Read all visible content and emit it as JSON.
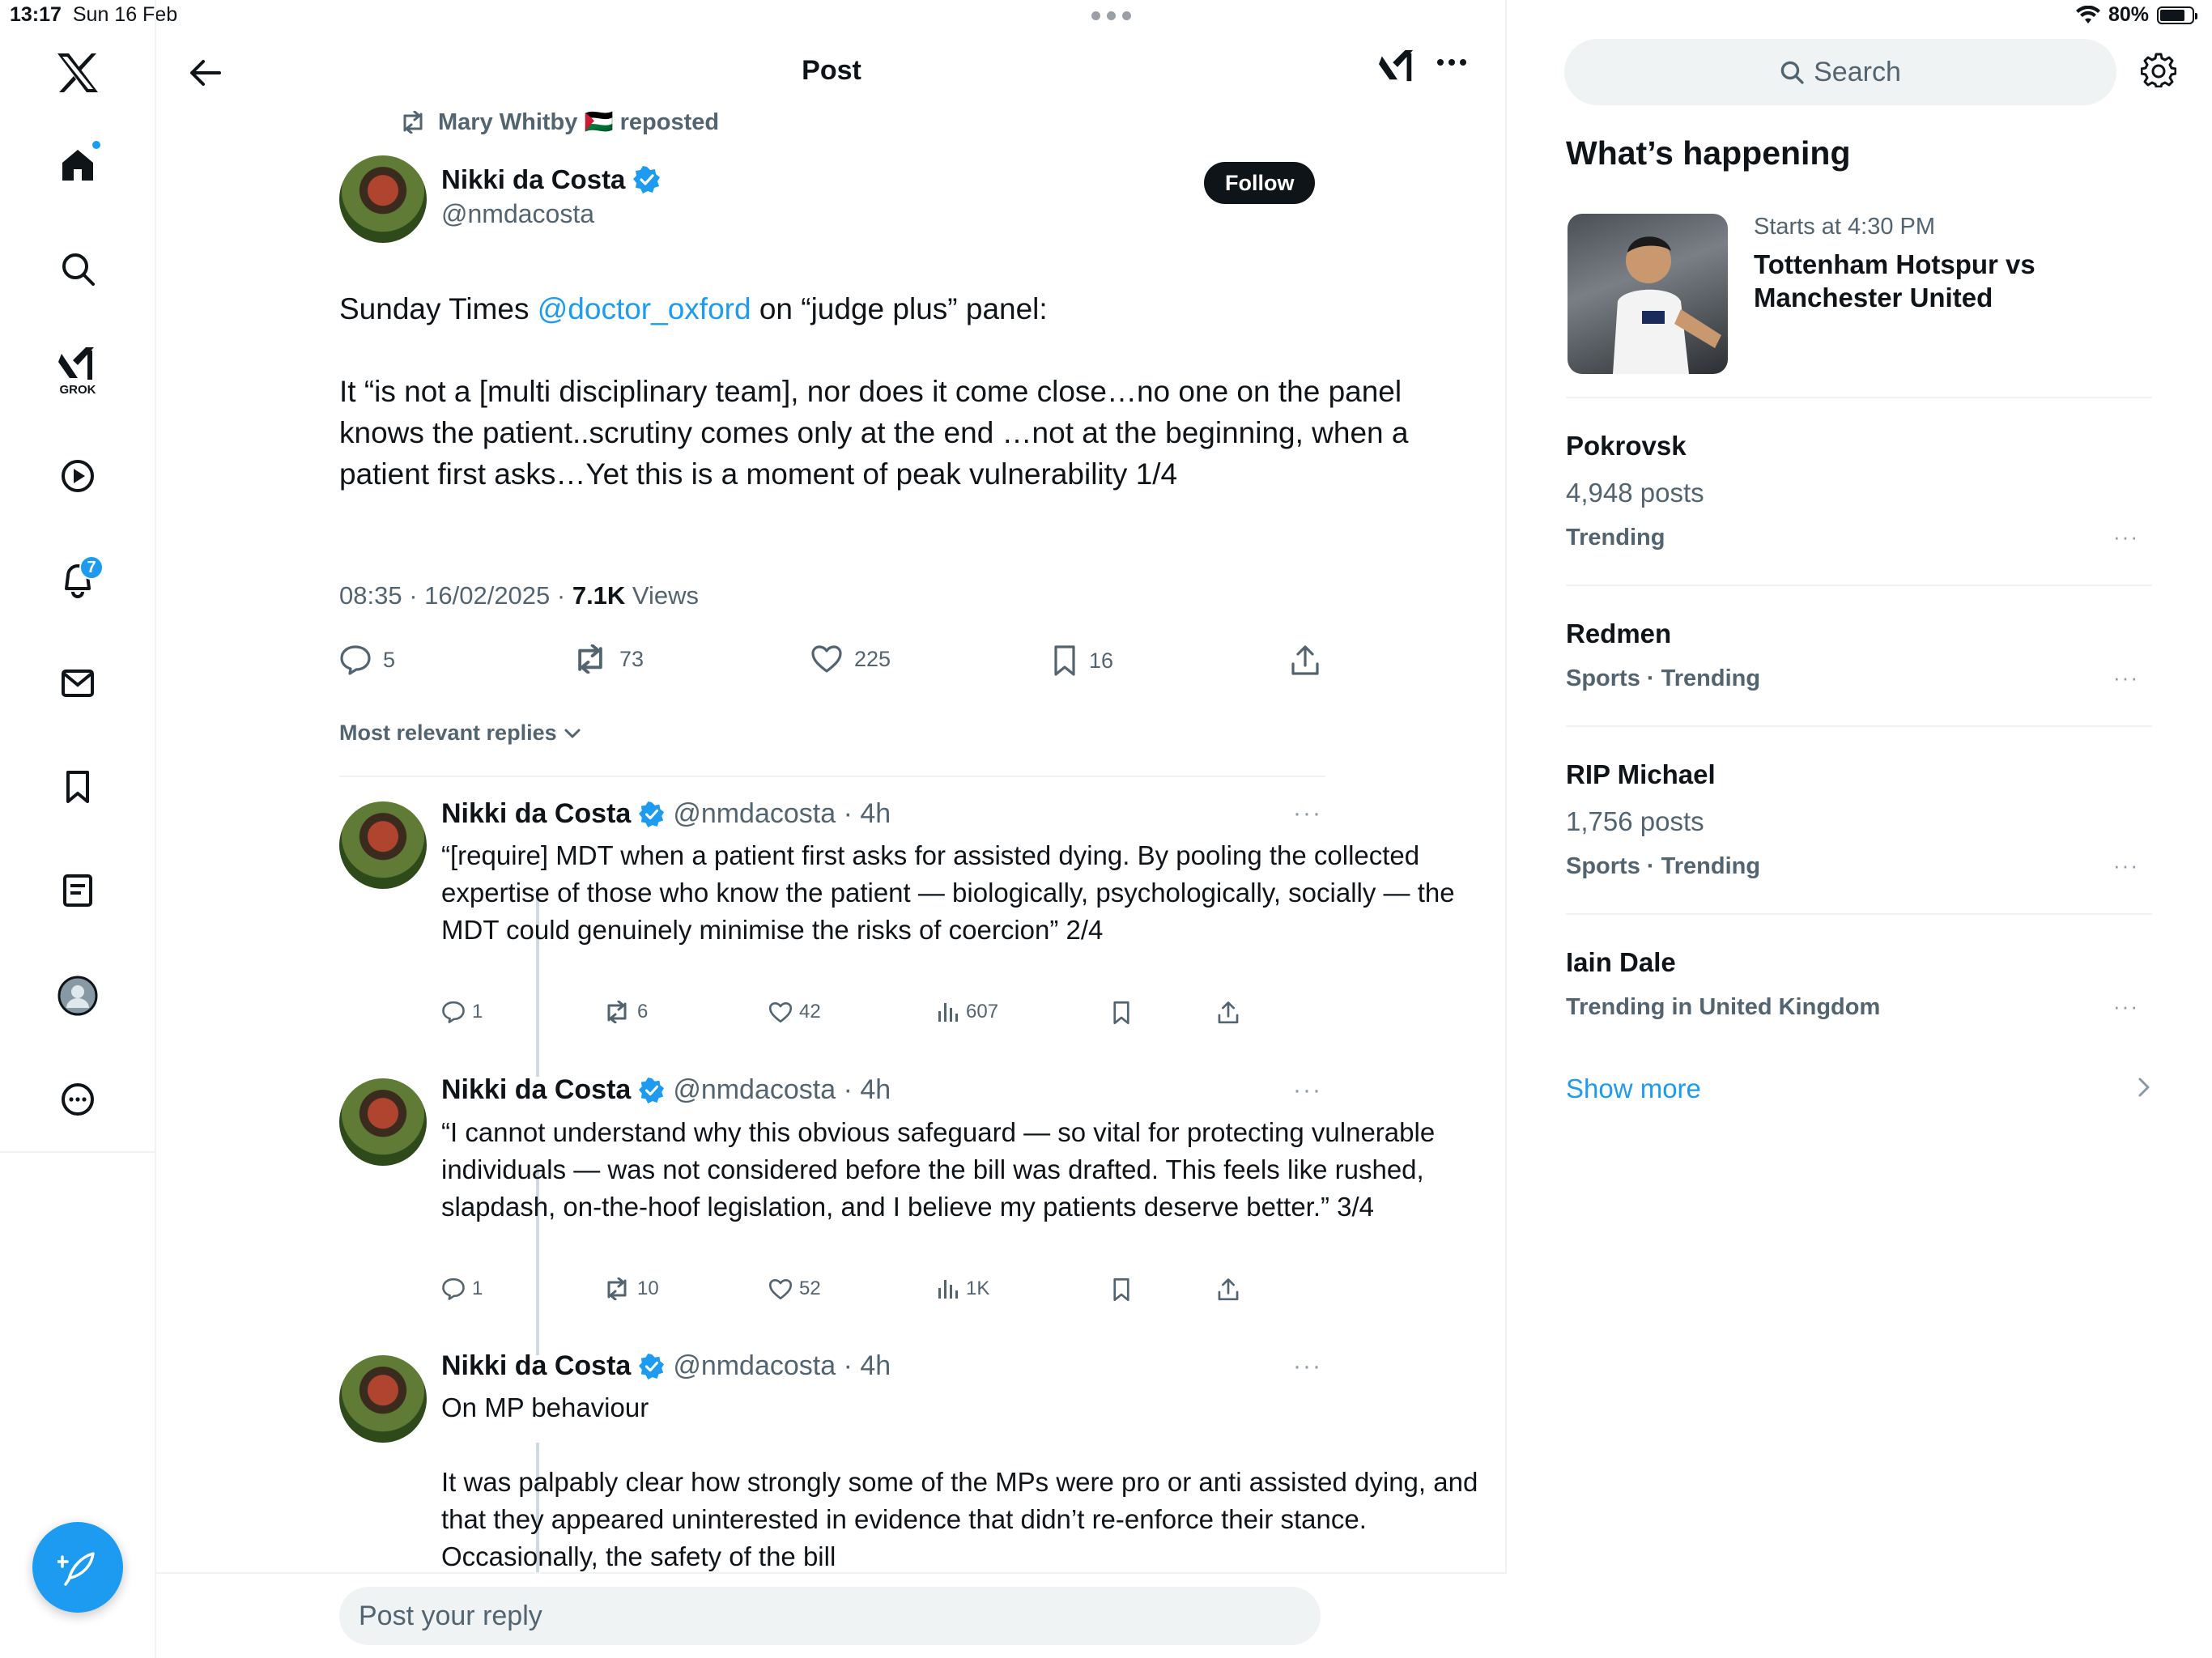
{
  "status_bar": {
    "time": "13:17",
    "date": "Sun 16 Feb",
    "battery": "80%",
    "battery_level": 0.8
  },
  "nav": {
    "items": [
      {
        "name": "x-logo-icon"
      },
      {
        "name": "home-icon"
      },
      {
        "name": "search-icon"
      },
      {
        "name": "grok-icon",
        "label": "GROK"
      },
      {
        "name": "video-icon"
      },
      {
        "name": "notifications-icon",
        "badge": "7"
      },
      {
        "name": "messages-icon"
      },
      {
        "name": "bookmarks-icon"
      },
      {
        "name": "lists-icon"
      },
      {
        "name": "profile-icon"
      },
      {
        "name": "more-icon"
      }
    ],
    "compose_icon": "feather-plus-icon"
  },
  "header": {
    "title": "Post"
  },
  "post": {
    "repost_by": "Mary Whitby 🇵🇸 reposted",
    "author": "Nikki da Costa",
    "handle": "@nmdacosta",
    "follow_label": "Follow",
    "text_1_pre": "Sunday Times ",
    "text_1_mention": "@doctor_oxford",
    "text_1_post": " on “judge plus” panel:",
    "text_2": "It “is not a [multi disciplinary team], nor does it come close…no one on the panel knows the patient..scrutiny comes only at the end …not at the beginning, when a patient first asks…Yet this is a moment of peak vulnerability 1/4",
    "timestamp": "08:35 · 16/02/2025 · ",
    "views_count": "7.1K",
    "views_label": " Views",
    "replies": "5",
    "reposts": "73",
    "likes": "225",
    "bookmarks": "16"
  },
  "sort": {
    "label": "Most relevant replies"
  },
  "replies": [
    {
      "author": "Nikki da Costa",
      "handle": "@nmdacosta · 4h",
      "text": "“[require] MDT when a patient first asks for assisted dying. By pooling the collected expertise of those who know the patient — biologically, psychologically, socially — the MDT could genuinely minimise the risks of coercion” 2/4",
      "replies": "1",
      "reposts": "6",
      "likes": "42",
      "views": "607"
    },
    {
      "author": "Nikki da Costa",
      "handle": "@nmdacosta · 4h",
      "text": "“I cannot understand why this obvious safeguard — so vital for protecting vulnerable individuals — was not considered before the bill was drafted. This feels like rushed, slapdash, on-the-hoof legislation, and I believe my patients deserve better.” 3/4",
      "replies": "1",
      "reposts": "10",
      "likes": "52",
      "views": "1K"
    },
    {
      "author": "Nikki da Costa",
      "handle": "@nmdacosta · 4h",
      "text_1": "On MP behaviour",
      "text_2": "It was palpably clear how strongly some of the MPs were pro or anti assisted dying, and that they appeared uninterested in evidence that didn’t re-enforce their stance. Occasionally, the safety of the bill"
    }
  ],
  "reply_bar": {
    "placeholder": "Post your reply"
  },
  "right": {
    "search_label": "Search",
    "whats_happening": "What’s happening",
    "event": {
      "subtitle": "Starts at 4:30 PM",
      "title": "Tottenham Hotspur vs Manchester United"
    },
    "trends": [
      {
        "name": "Pokrovsk",
        "posts": "4,948 posts",
        "context": "Trending"
      },
      {
        "name": "Redmen",
        "context": "Sports · Trending"
      },
      {
        "name": "RIP Michael",
        "posts": "1,756 posts",
        "context": "Sports · Trending"
      },
      {
        "name": "Iain Dale",
        "context": "Trending in United Kingdom"
      }
    ],
    "show_more": "Show more"
  },
  "colors": {
    "accent": "#1d9bf0",
    "text": "#0f1419",
    "muted": "#536471",
    "border": "#eff3f4"
  }
}
